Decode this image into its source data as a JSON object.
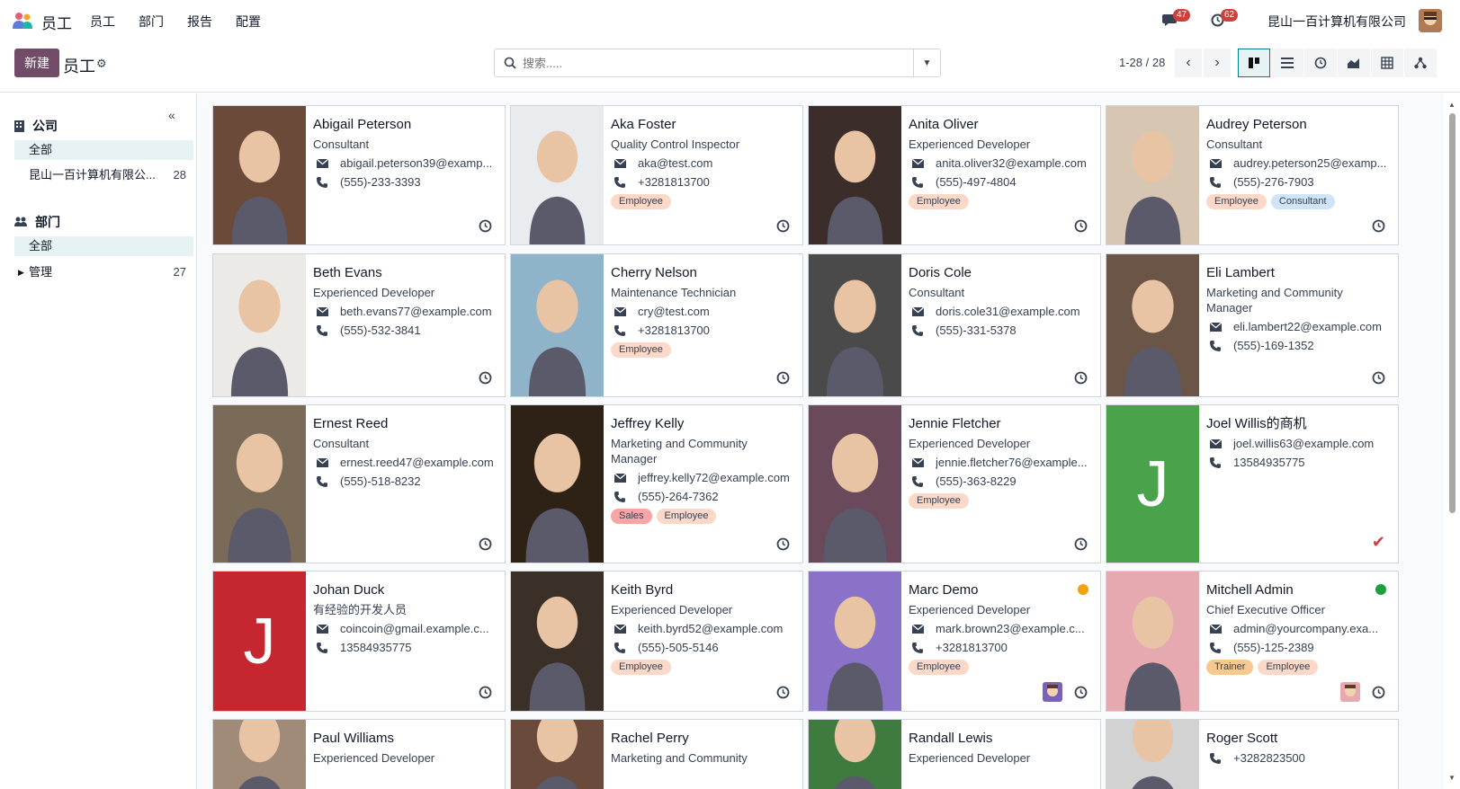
{
  "app": {
    "name": "员工",
    "menu": [
      "员工",
      "部门",
      "报告",
      "配置"
    ],
    "company": "昆山一百计算机有限公司",
    "chat_badge": "47",
    "activity_badge": "62"
  },
  "control": {
    "new_label": "新建",
    "title": "员工",
    "search_placeholder": "搜索.....",
    "pager": "1-28 / 28"
  },
  "sidebar": {
    "company_title": "公司",
    "company_items": [
      {
        "label": "全部",
        "count": ""
      },
      {
        "label": "昆山一百计算机有限公...",
        "count": "28"
      }
    ],
    "dept_title": "部门",
    "dept_items": [
      {
        "label": "全部",
        "count": ""
      },
      {
        "label": "管理",
        "count": "27"
      }
    ]
  },
  "colors": {
    "brand": "#714b67",
    "accent": "#017e84",
    "tag_employee": "#fbd8c8",
    "tag_consultant": "#cfe4f7",
    "tag_sales": "#f9a5a5",
    "tag_trainer": "#f7c98f"
  },
  "employees": [
    {
      "name": "Abigail Peterson",
      "job": "Consultant",
      "email": "abigail.peterson39@examp...",
      "phone": "(555)-233-3393",
      "tags": []
    },
    {
      "name": "Aka Foster",
      "job": "Quality Control Inspector",
      "email": "aka@test.com",
      "phone": "+3281813700",
      "tags": [
        "Employee"
      ]
    },
    {
      "name": "Anita Oliver",
      "job": "Experienced Developer",
      "email": "anita.oliver32@example.com",
      "phone": "(555)-497-4804",
      "tags": [
        "Employee"
      ]
    },
    {
      "name": "Audrey Peterson",
      "job": "Consultant",
      "email": "audrey.peterson25@examp...",
      "phone": "(555)-276-7903",
      "tags": [
        "Employee",
        "Consultant"
      ]
    },
    {
      "name": "Beth Evans",
      "job": "Experienced Developer",
      "email": "beth.evans77@example.com",
      "phone": "(555)-532-3841",
      "tags": []
    },
    {
      "name": "Cherry Nelson",
      "job": "Maintenance Technician",
      "email": "cry@test.com",
      "phone": "+3281813700",
      "tags": [
        "Employee"
      ]
    },
    {
      "name": "Doris Cole",
      "job": "Consultant",
      "email": "doris.cole31@example.com",
      "phone": "(555)-331-5378",
      "tags": []
    },
    {
      "name": "Eli Lambert",
      "job": "Marketing and Community Manager",
      "email": "eli.lambert22@example.com",
      "phone": "(555)-169-1352",
      "tags": []
    },
    {
      "name": "Ernest Reed",
      "job": "Consultant",
      "email": "ernest.reed47@example.com",
      "phone": "(555)-518-8232",
      "tags": []
    },
    {
      "name": "Jeffrey Kelly",
      "job": "Marketing and Community Manager",
      "email": "jeffrey.kelly72@example.com",
      "phone": "(555)-264-7362",
      "tags": [
        "Sales",
        "Employee"
      ]
    },
    {
      "name": "Jennie Fletcher",
      "job": "Experienced Developer",
      "email": "jennie.fletcher76@example...",
      "phone": "(555)-363-8229",
      "tags": [
        "Employee"
      ]
    },
    {
      "name": "Joel Willis的商机",
      "job": "",
      "email": "joel.willis63@example.com",
      "phone": "13584935775",
      "tags": [],
      "initial": "J"
    },
    {
      "name": "Johan Duck",
      "job": "有经验的开发人员",
      "email": "coincoin@gmail.example.c...",
      "phone": "13584935775",
      "tags": [],
      "initial": "J"
    },
    {
      "name": "Keith Byrd",
      "job": "Experienced Developer",
      "email": "keith.byrd52@example.com",
      "phone": "(555)-505-5146",
      "tags": [
        "Employee"
      ]
    },
    {
      "name": "Marc Demo",
      "job": "Experienced Developer",
      "email": "mark.brown23@example.c...",
      "phone": "+3281813700",
      "tags": [
        "Employee"
      ]
    },
    {
      "name": "Mitchell Admin",
      "job": "Chief Executive Officer",
      "email": "admin@yourcompany.exa...",
      "phone": "(555)-125-2389",
      "tags": [
        "Trainer",
        "Employee"
      ]
    },
    {
      "name": "Paul Williams",
      "job": "Experienced Developer",
      "email": "",
      "phone": "",
      "tags": []
    },
    {
      "name": "Rachel Perry",
      "job": "Marketing and Community",
      "email": "",
      "phone": "",
      "tags": []
    },
    {
      "name": "Randall Lewis",
      "job": "Experienced Developer",
      "email": "",
      "phone": "",
      "tags": []
    },
    {
      "name": "Roger Scott",
      "job": "",
      "email": "",
      "phone": "+3282823500",
      "tags": []
    }
  ]
}
